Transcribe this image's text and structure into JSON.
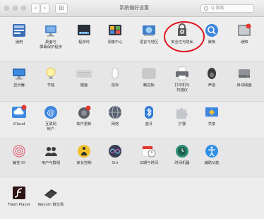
{
  "window": {
    "title": "系统偏好设置",
    "back": "‹",
    "forward": "›",
    "grid": "⊞",
    "search_placeholder": "Q 搜索"
  },
  "rows": [
    [
      {
        "label": "通用",
        "icon": "general-icon"
      },
      {
        "label": "桌面与\n屏幕保护程序",
        "icon": "desktop-screensaver-icon"
      },
      {
        "label": "程序坞",
        "icon": "dock-icon"
      },
      {
        "label": "调度中心",
        "icon": "mission-control-icon"
      },
      {
        "label": "语言与地区",
        "icon": "language-region-icon"
      },
      {
        "label": "安全性与隐私",
        "icon": "security-privacy-icon"
      },
      {
        "label": "聚焦",
        "icon": "spotlight-icon"
      },
      {
        "label": "通知",
        "icon": "notifications-icon"
      }
    ],
    [
      {
        "label": "显示器",
        "icon": "displays-icon"
      },
      {
        "label": "节能",
        "icon": "energy-saver-icon"
      },
      {
        "label": "键盘",
        "icon": "keyboard-icon"
      },
      {
        "label": "鼠标",
        "icon": "mouse-icon"
      },
      {
        "label": "触控板",
        "icon": "trackpad-icon"
      },
      {
        "label": "打印机与\n扫描仪",
        "icon": "printers-scanners-icon"
      },
      {
        "label": "声音",
        "icon": "sound-icon"
      },
      {
        "label": "启动磁盘",
        "icon": "startup-disk-icon"
      }
    ],
    [
      {
        "label": "iCloud",
        "icon": "icloud-icon"
      },
      {
        "label": "互联网\n帐户",
        "icon": "internet-accounts-icon"
      },
      {
        "label": "软件更新",
        "icon": "software-update-icon"
      },
      {
        "label": "网络",
        "icon": "network-icon"
      },
      {
        "label": "蓝牙",
        "icon": "bluetooth-icon"
      },
      {
        "label": "扩展",
        "icon": "extensions-icon"
      },
      {
        "label": "共享",
        "icon": "sharing-icon"
      }
    ],
    [
      {
        "label": "触控 ID",
        "icon": "touch-id-icon"
      },
      {
        "label": "用户与群组",
        "icon": "users-groups-icon"
      },
      {
        "label": "家长控制",
        "icon": "parental-controls-icon"
      },
      {
        "label": "Siri",
        "icon": "siri-icon"
      },
      {
        "label": "日期与时间",
        "icon": "date-time-icon"
      },
      {
        "label": "时间机器",
        "icon": "time-machine-icon"
      },
      {
        "label": "辅助功能",
        "icon": "accessibility-icon"
      }
    ],
    [
      {
        "label": "Flash Player",
        "icon": "flash-player-icon"
      },
      {
        "label": "Wacom 数位板",
        "icon": "wacom-tablet-icon"
      }
    ]
  ],
  "annotation": {
    "highlighted_item": "安全性与隐私",
    "color": "#e0141e"
  }
}
